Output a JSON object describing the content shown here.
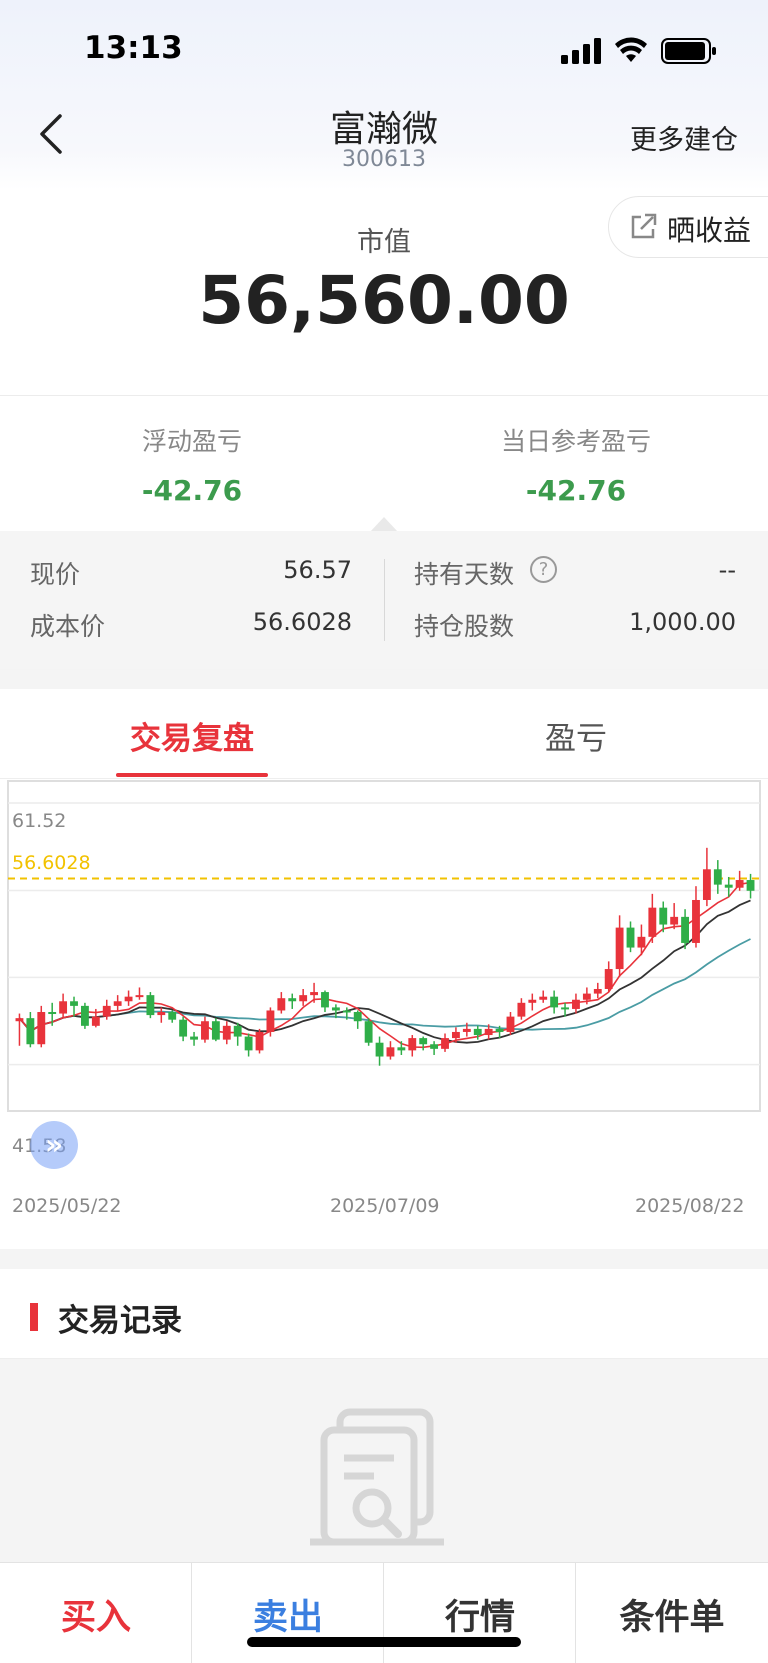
{
  "status_bar": {
    "time": "13:13"
  },
  "header": {
    "stock_name": "富瀚微",
    "stock_code": "300613",
    "more_label": "更多建仓",
    "share_label": "晒收益"
  },
  "summary": {
    "market_value_label": "市值",
    "market_value": "56,560.00",
    "floating_pl_label": "浮动盈亏",
    "floating_pl": "-42.76",
    "daily_pl_label": "当日参考盈亏",
    "daily_pl": "-42.76"
  },
  "details": {
    "price_label": "现价",
    "price": "56.57",
    "cost_label": "成本价",
    "cost": "56.6028",
    "days_label": "持有天数",
    "days": "--",
    "shares_label": "持仓股数",
    "shares": "1,000.00"
  },
  "tabs": [
    {
      "label": "交易复盘",
      "active": true
    },
    {
      "label": "盈亏",
      "active": false
    }
  ],
  "chart_data": {
    "type": "candlestick",
    "y_max_label": "61.52",
    "y_min_label": "41.58",
    "ylim": [
      41.58,
      61.52
    ],
    "cost_line": 56.6028,
    "cost_line_label": "56.6028",
    "x_tick_labels": [
      "2025/05/22",
      "2025/07/09",
      "2025/08/22"
    ],
    "candles": [
      [
        47.3,
        47.5,
        45.7,
        47.8
      ],
      [
        47.5,
        45.8,
        45.6,
        47.9
      ],
      [
        45.8,
        47.9,
        45.6,
        48.3
      ],
      [
        47.9,
        47.8,
        47.0,
        48.5
      ],
      [
        47.8,
        48.6,
        47.5,
        49.1
      ],
      [
        48.6,
        48.3,
        47.6,
        48.9
      ],
      [
        48.3,
        47.0,
        46.8,
        48.5
      ],
      [
        47.0,
        47.6,
        46.9,
        48.1
      ],
      [
        47.6,
        48.3,
        47.4,
        48.7
      ],
      [
        48.3,
        48.6,
        48.0,
        49.0
      ],
      [
        48.6,
        48.9,
        48.3,
        49.3
      ],
      [
        48.9,
        49.0,
        48.7,
        49.5
      ],
      [
        49.0,
        47.7,
        47.5,
        49.2
      ],
      [
        47.7,
        47.9,
        47.2,
        48.2
      ],
      [
        47.9,
        47.4,
        47.2,
        48.0
      ],
      [
        47.4,
        46.3,
        46.0,
        47.6
      ],
      [
        46.3,
        46.1,
        45.7,
        46.6
      ],
      [
        46.1,
        47.3,
        45.9,
        47.6
      ],
      [
        47.3,
        46.1,
        46.0,
        47.5
      ],
      [
        46.1,
        47.0,
        45.8,
        47.3
      ],
      [
        47.0,
        46.3,
        45.7,
        47.2
      ],
      [
        46.3,
        45.4,
        45.0,
        46.5
      ],
      [
        45.4,
        46.6,
        45.2,
        46.8
      ],
      [
        46.6,
        48.0,
        46.3,
        48.2
      ],
      [
        48.0,
        48.8,
        47.8,
        49.2
      ],
      [
        48.8,
        48.6,
        48.1,
        49.1
      ],
      [
        48.6,
        49.0,
        48.3,
        49.4
      ],
      [
        49.0,
        49.2,
        48.5,
        49.8
      ],
      [
        49.2,
        48.2,
        47.9,
        49.3
      ],
      [
        48.2,
        48.0,
        47.5,
        48.4
      ],
      [
        48.0,
        47.9,
        47.4,
        48.2
      ],
      [
        47.9,
        47.3,
        46.8,
        48.0
      ],
      [
        47.3,
        45.9,
        45.7,
        47.5
      ],
      [
        45.9,
        45.0,
        44.4,
        46.3
      ],
      [
        45.0,
        45.6,
        44.8,
        46.0
      ],
      [
        45.6,
        45.4,
        45.1,
        46.0
      ],
      [
        45.4,
        46.2,
        45.0,
        46.4
      ],
      [
        46.2,
        45.8,
        45.4,
        46.3
      ],
      [
        45.8,
        45.5,
        45.1,
        46.0
      ],
      [
        45.5,
        46.2,
        45.3,
        46.5
      ],
      [
        46.2,
        46.6,
        45.9,
        46.9
      ],
      [
        46.6,
        46.8,
        46.3,
        47.2
      ],
      [
        46.8,
        46.4,
        46.1,
        47.0
      ],
      [
        46.4,
        46.8,
        46.1,
        47.1
      ],
      [
        46.8,
        46.6,
        46.2,
        47.0
      ],
      [
        46.6,
        47.6,
        46.4,
        47.9
      ],
      [
        47.6,
        48.5,
        47.4,
        48.8
      ],
      [
        48.5,
        48.7,
        48.0,
        49.1
      ],
      [
        48.7,
        48.9,
        48.5,
        49.3
      ],
      [
        48.9,
        48.2,
        47.8,
        49.3
      ],
      [
        48.2,
        48.1,
        47.6,
        48.5
      ],
      [
        48.1,
        48.7,
        47.8,
        49.1
      ],
      [
        48.7,
        49.1,
        48.4,
        49.5
      ],
      [
        49.1,
        49.4,
        48.8,
        49.8
      ],
      [
        49.4,
        50.7,
        49.2,
        51.2
      ],
      [
        50.7,
        53.4,
        50.2,
        54.2
      ],
      [
        53.4,
        52.1,
        51.8,
        53.8
      ],
      [
        52.1,
        52.8,
        51.6,
        53.6
      ],
      [
        52.8,
        54.7,
        52.4,
        55.6
      ],
      [
        54.7,
        53.6,
        53.1,
        55.1
      ],
      [
        53.6,
        54.1,
        53.3,
        55.0
      ],
      [
        54.1,
        52.4,
        52.0,
        54.6
      ],
      [
        52.4,
        55.2,
        52.1,
        56.1
      ],
      [
        55.2,
        57.2,
        54.8,
        58.6
      ],
      [
        57.2,
        56.2,
        55.6,
        57.8
      ],
      [
        56.2,
        56.0,
        55.4,
        56.7
      ],
      [
        56.0,
        56.5,
        55.8,
        57.1
      ],
      [
        56.5,
        55.8,
        55.3,
        56.9
      ]
    ]
  },
  "records": {
    "title": "交易记录"
  },
  "bottom_bar": {
    "buy": "买入",
    "sell": "卖出",
    "quote": "行情",
    "conditional": "条件单",
    "buy_color": "#e8333b",
    "sell_color": "#3b7fe0",
    "neutral_color": "#333333"
  },
  "colors": {
    "up": "#e8333b",
    "down": "#2fae48",
    "cost_line": "#f2c200",
    "ma5": "#e8333b",
    "ma10": "#333333",
    "ma20": "#4a9ca4"
  }
}
